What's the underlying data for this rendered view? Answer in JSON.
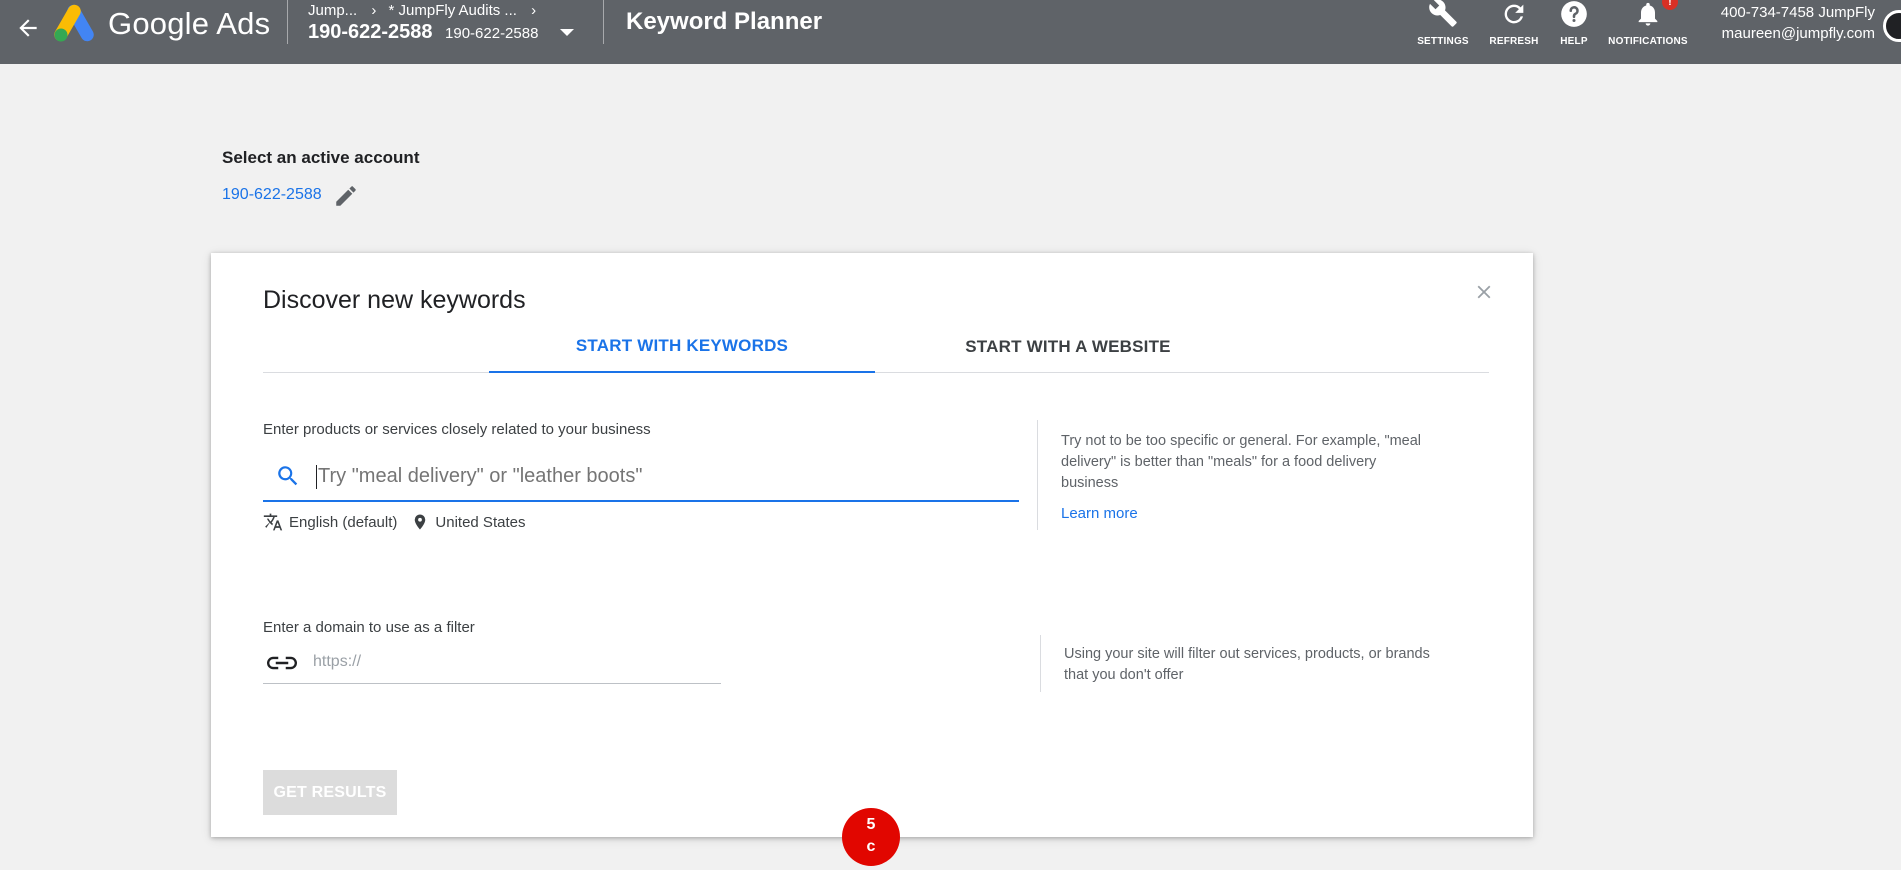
{
  "topbar": {
    "brand": "Google Ads",
    "breadcrumb": [
      "Jump...",
      "* JumpFly Audits ..."
    ],
    "account_main": "190-622-2588",
    "account_sub": "190-622-2588",
    "page_title": "Keyword Planner",
    "buttons": [
      {
        "label": "SETTINGS",
        "icon": "wrench-icon"
      },
      {
        "label": "REFRESH",
        "icon": "refresh-icon"
      },
      {
        "label": "HELP",
        "icon": "help-icon"
      },
      {
        "label": "NOTIFICATIONS",
        "icon": "bell-icon"
      }
    ],
    "notification_badge": "!",
    "user_line1": "400-734-7458 JumpFly",
    "user_line2": "maureen@jumpfly.com"
  },
  "account_section": {
    "title": "Select an active account",
    "account_link": "190-622-2588"
  },
  "card": {
    "title": "Discover new keywords",
    "tabs": [
      {
        "label": "START WITH KEYWORDS",
        "active": true
      },
      {
        "label": "START WITH A WEBSITE",
        "active": false
      }
    ],
    "keywords_label": "Enter products or services closely related to your business",
    "keywords_placeholder": "Try \"meal delivery\" or \"leather boots\"",
    "language": "English (default)",
    "location": "United States",
    "keywords_hint": "Try not to be too specific or general. For example, \"meal delivery\" is better than \"meals\" for a food delivery business",
    "learn_more": "Learn more",
    "domain_label": "Enter a domain to use as a filter",
    "domain_placeholder": "https://",
    "domain_hint": "Using your site will filter out services, products, or brands that you don't offer",
    "get_results": "GET RESULTS"
  },
  "step_marker": {
    "line1": "5",
    "line2": "c"
  },
  "colors": {
    "topbar": "#5f6368",
    "accent": "#1a73e8",
    "background": "#f1f1f1",
    "marker": "#e10600"
  }
}
